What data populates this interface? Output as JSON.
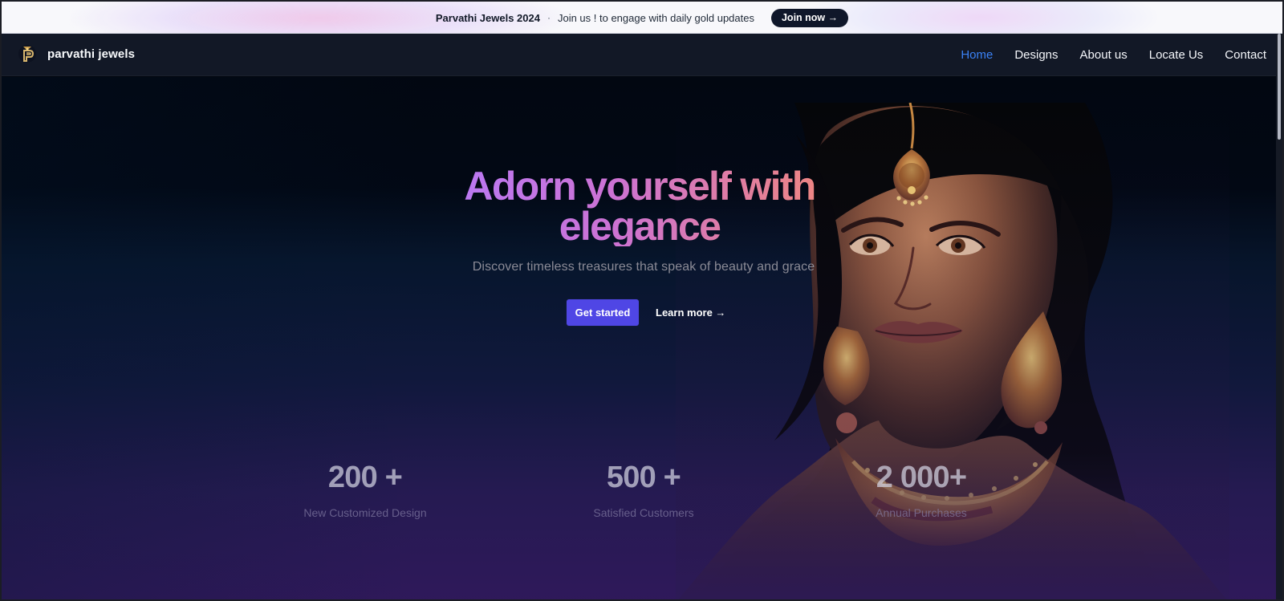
{
  "banner": {
    "title": "Parvathi Jewels 2024",
    "separator": "·",
    "message": "Join us ! to engage with daily gold updates",
    "join_label": "Join now →"
  },
  "nav": {
    "brand": "parvathi jewels",
    "logo_icon": "p-jewel-logo-icon",
    "items": [
      {
        "label": "Home",
        "active": true
      },
      {
        "label": "Designs",
        "active": false
      },
      {
        "label": "About us",
        "active": false
      },
      {
        "label": "Locate Us",
        "active": false
      },
      {
        "label": "Contact",
        "active": false
      }
    ],
    "active_color": "#3b82f6"
  },
  "hero": {
    "title": "Adorn yourself with elegance",
    "subtitle": "Discover timeless treasures that speak of beauty and grace",
    "primary_cta": "Get started",
    "secondary_cta": "Learn more →",
    "accent_color": "#4f46e5",
    "title_gradient": [
      "#b879f6",
      "#cc72d4",
      "#f0877b"
    ]
  },
  "stats": [
    {
      "value": "200 +",
      "label": "New Customized Design"
    },
    {
      "value": "500 +",
      "label": "Satisfied Customers"
    },
    {
      "value": "2 000+",
      "label": "Annual Purchases"
    }
  ]
}
